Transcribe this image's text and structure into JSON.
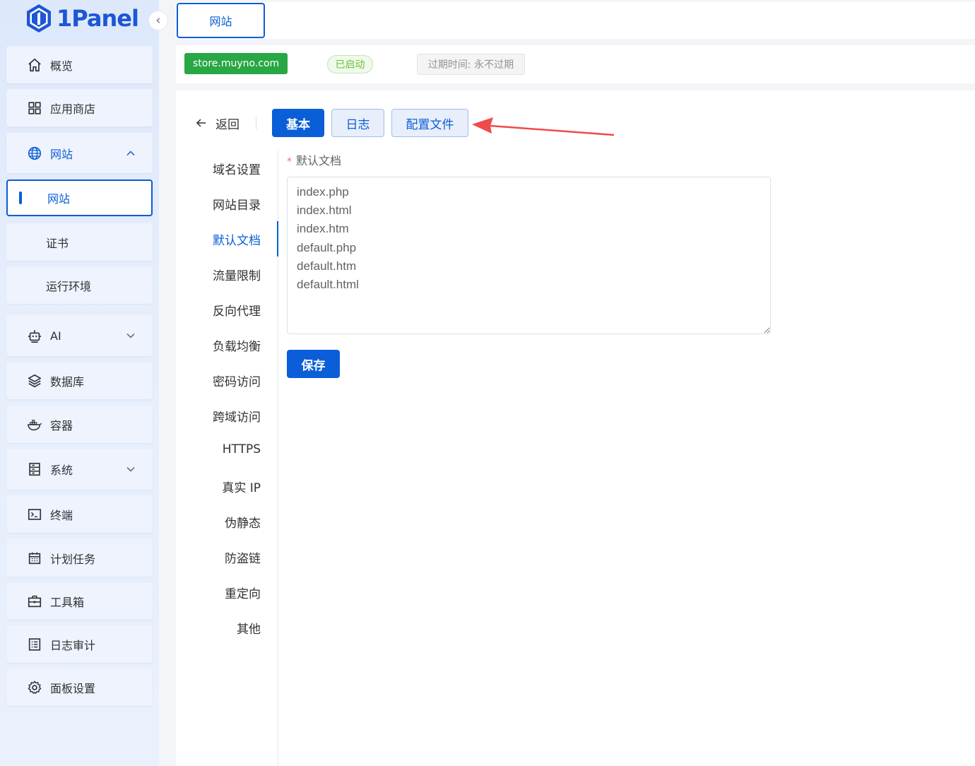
{
  "brand": {
    "name": "1Panel",
    "color": "#1d56d6"
  },
  "colors": {
    "primary": "#0a5ed7",
    "success": "#28a745",
    "annotation": "#f04a4a"
  },
  "sidebar": {
    "collapse_icon": "chevron-left-icon",
    "items": [
      {
        "label": "概览",
        "icon": "home-icon"
      },
      {
        "label": "应用商店",
        "icon": "grid-icon"
      },
      {
        "label": "网站",
        "icon": "globe-icon",
        "expanded": true
      },
      {
        "label": "网站",
        "sub": true,
        "active": true
      },
      {
        "label": "证书",
        "sub": true
      },
      {
        "label": "运行环境",
        "sub": true
      },
      {
        "label": "AI",
        "icon": "robot-icon",
        "expandable": true
      },
      {
        "label": "数据库",
        "icon": "layers-icon"
      },
      {
        "label": "容器",
        "icon": "docker-icon"
      },
      {
        "label": "系统",
        "icon": "server-icon",
        "expandable": true
      },
      {
        "label": "终端",
        "icon": "terminal-icon"
      },
      {
        "label": "计划任务",
        "icon": "calendar-icon"
      },
      {
        "label": "工具箱",
        "icon": "toolbox-icon"
      },
      {
        "label": "日志审计",
        "icon": "log-icon"
      },
      {
        "label": "面板设置",
        "icon": "gear-icon"
      }
    ]
  },
  "topbar": {
    "tab_label": "网站"
  },
  "site_info": {
    "domain": "store.muyno.com",
    "status": "已启动",
    "expire": "过期时间: 永不过期"
  },
  "main": {
    "back_label": "返回",
    "tabs": [
      {
        "label": "基本",
        "active": true
      },
      {
        "label": "日志"
      },
      {
        "label": "配置文件"
      }
    ],
    "menu": [
      {
        "label": "域名设置"
      },
      {
        "label": "网站目录"
      },
      {
        "label": "默认文档",
        "active": true
      },
      {
        "label": "流量限制"
      },
      {
        "label": "反向代理"
      },
      {
        "label": "负载均衡"
      },
      {
        "label": "密码访问"
      },
      {
        "label": "跨域访问"
      },
      {
        "label": "HTTPS"
      },
      {
        "label": "真实 IP"
      },
      {
        "label": "伪静态"
      },
      {
        "label": "防盗链"
      },
      {
        "label": "重定向"
      },
      {
        "label": "其他"
      }
    ],
    "form": {
      "required_mark": "*",
      "label": "默认文档",
      "documents": "index.php\nindex.html\nindex.htm\ndefault.php\ndefault.htm\ndefault.html",
      "save_label": "保存"
    }
  }
}
